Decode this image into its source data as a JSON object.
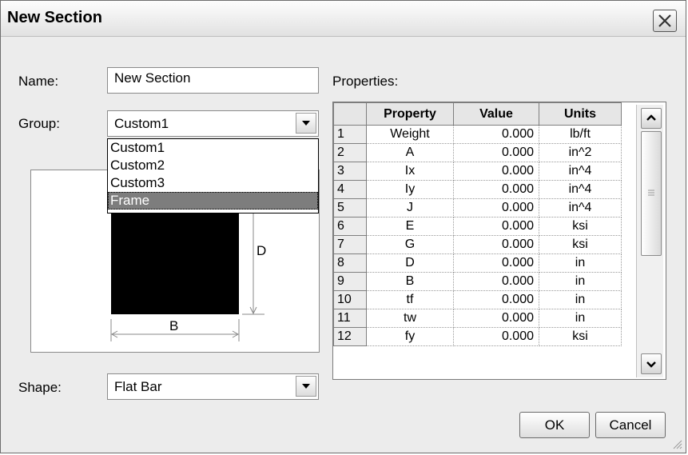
{
  "window": {
    "title": "New Section"
  },
  "form": {
    "name_label": "Name:",
    "name_value": "New Section",
    "group_label": "Group:",
    "group_value": "Custom1",
    "group_options": [
      "Custom1",
      "Custom2",
      "Custom3",
      "Frame"
    ],
    "group_highlighted": "Frame",
    "shape_label": "Shape:",
    "shape_value": "Flat Bar"
  },
  "preview": {
    "dim_d": "D",
    "dim_b": "B"
  },
  "properties": {
    "label": "Properties:",
    "headers": [
      "Property",
      "Value",
      "Units"
    ],
    "rows": [
      {
        "n": "1",
        "property": "Weight",
        "value": "0.000",
        "units": "lb/ft"
      },
      {
        "n": "2",
        "property": "A",
        "value": "0.000",
        "units": "in^2"
      },
      {
        "n": "3",
        "property": "Ix",
        "value": "0.000",
        "units": "in^4"
      },
      {
        "n": "4",
        "property": "Iy",
        "value": "0.000",
        "units": "in^4"
      },
      {
        "n": "5",
        "property": "J",
        "value": "0.000",
        "units": "in^4"
      },
      {
        "n": "6",
        "property": "E",
        "value": "0.000",
        "units": "ksi"
      },
      {
        "n": "7",
        "property": "G",
        "value": "0.000",
        "units": "ksi"
      },
      {
        "n": "8",
        "property": "D",
        "value": "0.000",
        "units": "in"
      },
      {
        "n": "9",
        "property": "B",
        "value": "0.000",
        "units": "in"
      },
      {
        "n": "10",
        "property": "tf",
        "value": "0.000",
        "units": "in"
      },
      {
        "n": "11",
        "property": "tw",
        "value": "0.000",
        "units": "in"
      },
      {
        "n": "12",
        "property": "fy",
        "value": "0.000",
        "units": "ksi"
      }
    ]
  },
  "buttons": {
    "ok": "OK",
    "cancel": "Cancel"
  },
  "icons": {
    "close": "close-icon",
    "combo_arrow": "chevron-down-icon",
    "scroll_up": "scroll-up-icon",
    "scroll_down": "scroll-down-icon",
    "grip": "resize-grip-icon"
  }
}
